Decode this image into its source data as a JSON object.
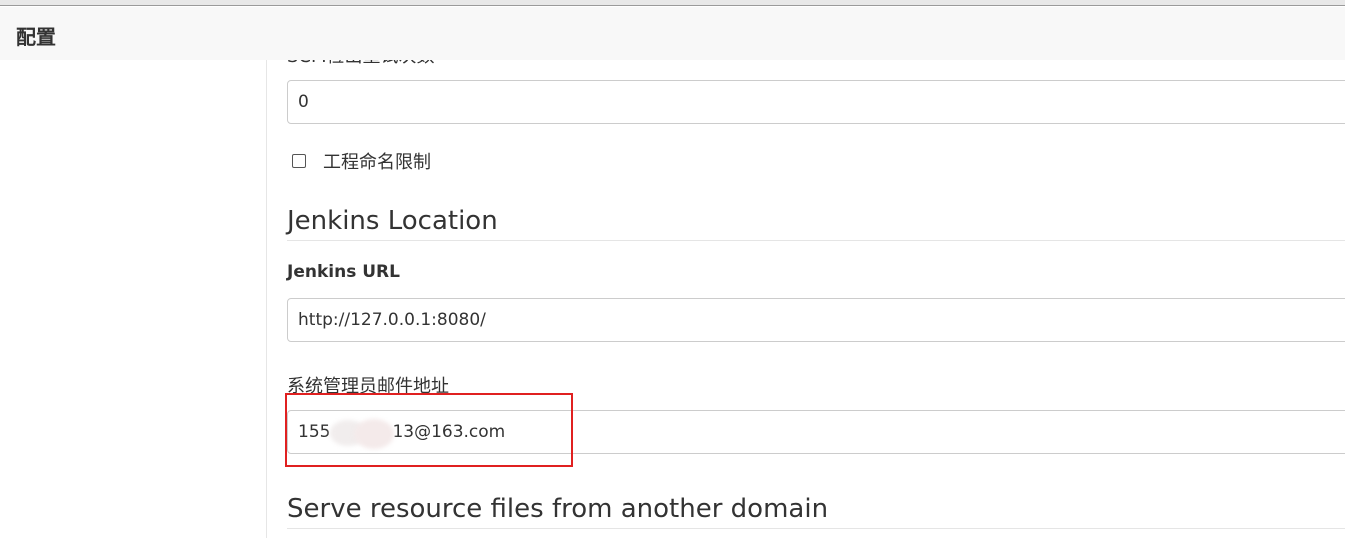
{
  "header": {
    "title": "配置"
  },
  "main": {
    "cut_off_label": "SCM检出重试次数",
    "retry_input": {
      "value": "0"
    },
    "project_naming": {
      "label": "工程命名限制",
      "checked": false
    },
    "jenkins_location": {
      "title": "Jenkins Location",
      "url_label": "Jenkins URL",
      "url_value": "http://127.0.0.1:8080/",
      "email_label": "系统管理员邮件地址",
      "email_value_prefix": "155",
      "email_value_suffix": "13@163.com"
    },
    "serve_resource": {
      "title": "Serve resource files from another domain"
    }
  },
  "annotation": {
    "highlight_color": "#e02020"
  }
}
